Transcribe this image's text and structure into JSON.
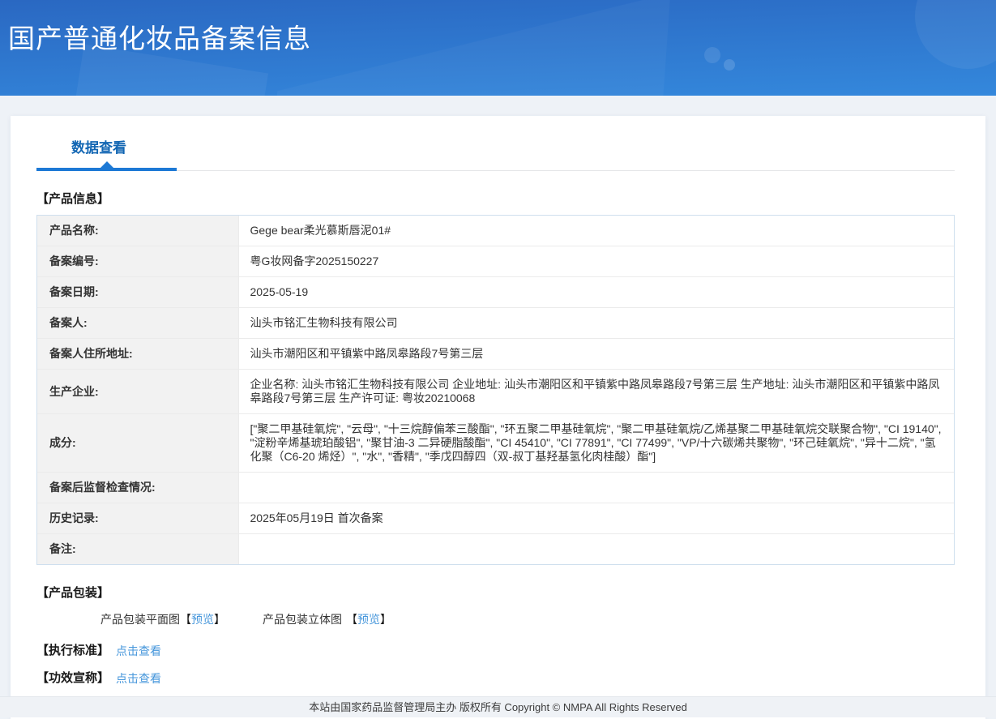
{
  "header": {
    "title": "国产普通化妆品备案信息"
  },
  "tabs": {
    "data_view": "数据查看"
  },
  "product_info": {
    "section_title": "【产品信息】",
    "rows": [
      {
        "label": "产品名称:",
        "value": "Gege bear柔光慕斯唇泥01#"
      },
      {
        "label": "备案编号:",
        "value": "粤G妆网备字2025150227"
      },
      {
        "label": "备案日期:",
        "value": "2025-05-19"
      },
      {
        "label": "备案人:",
        "value": "汕头市铭汇生物科技有限公司"
      },
      {
        "label": "备案人住所地址:",
        "value": "汕头市潮阳区和平镇紫中路凤皋路段7号第三层"
      },
      {
        "label": "生产企业:",
        "value": "企业名称: 汕头市铭汇生物科技有限公司 企业地址: 汕头市潮阳区和平镇紫中路凤皋路段7号第三层 生产地址: 汕头市潮阳区和平镇紫中路凤皋路段7号第三层 生产许可证: 粤妆20210068"
      },
      {
        "label": "成分:",
        "value": "[\"聚二甲基硅氧烷\", \"云母\", \"十三烷醇偏苯三酸酯\", \"环五聚二甲基硅氧烷\", \"聚二甲基硅氧烷/乙烯基聚二甲基硅氧烷交联聚合物\", \"CI 19140\", \"淀粉辛烯基琥珀酸铝\", \"聚甘油-3 二异硬脂酸酯\", \"CI 45410\", \"CI 77891\", \"CI 77499\", \"VP/十六碳烯共聚物\", \"环己硅氧烷\", \"异十二烷\", \"氢化聚（C6-20 烯烃）\", \"水\", \"香精\", \"季戊四醇四（双-叔丁基羟基氢化肉桂酸）酯\"]"
      },
      {
        "label": "备案后监督检查情况:",
        "value": ""
      },
      {
        "label": "历史记录:",
        "value": "2025年05月19日 首次备案"
      },
      {
        "label": "备注:",
        "value": ""
      }
    ]
  },
  "packaging": {
    "section_title": "【产品包装】",
    "items": [
      {
        "label": "产品包装平面图",
        "bracket_open": "【",
        "link": "预览",
        "bracket_close": "】"
      },
      {
        "label": "产品包装立体图",
        "bracket_open": "【",
        "link": "预览",
        "bracket_close": "】"
      }
    ]
  },
  "standard": {
    "section_title": "【执行标准】",
    "link": "点击查看"
  },
  "efficacy": {
    "section_title": "【功效宣称】",
    "link": "点击查看"
  },
  "footer": {
    "text": "本站由国家药品监督管理局主办 版权所有 Copyright © NMPA All Rights Reserved"
  },
  "colors": {
    "header-grad-top": "#2a68c2",
    "header-grad-bottom": "#3488dc",
    "tab-text": "#1266b3",
    "tab-underline": "#1d79d5",
    "link": "#4596db",
    "label-bg": "#f2f2f2",
    "table-border-outer": "#cfdfee",
    "table-border-inner": "#ebebeb",
    "text": "#333333",
    "page-bg": "#eef2f7",
    "footer-bg": "#eff2f6"
  }
}
